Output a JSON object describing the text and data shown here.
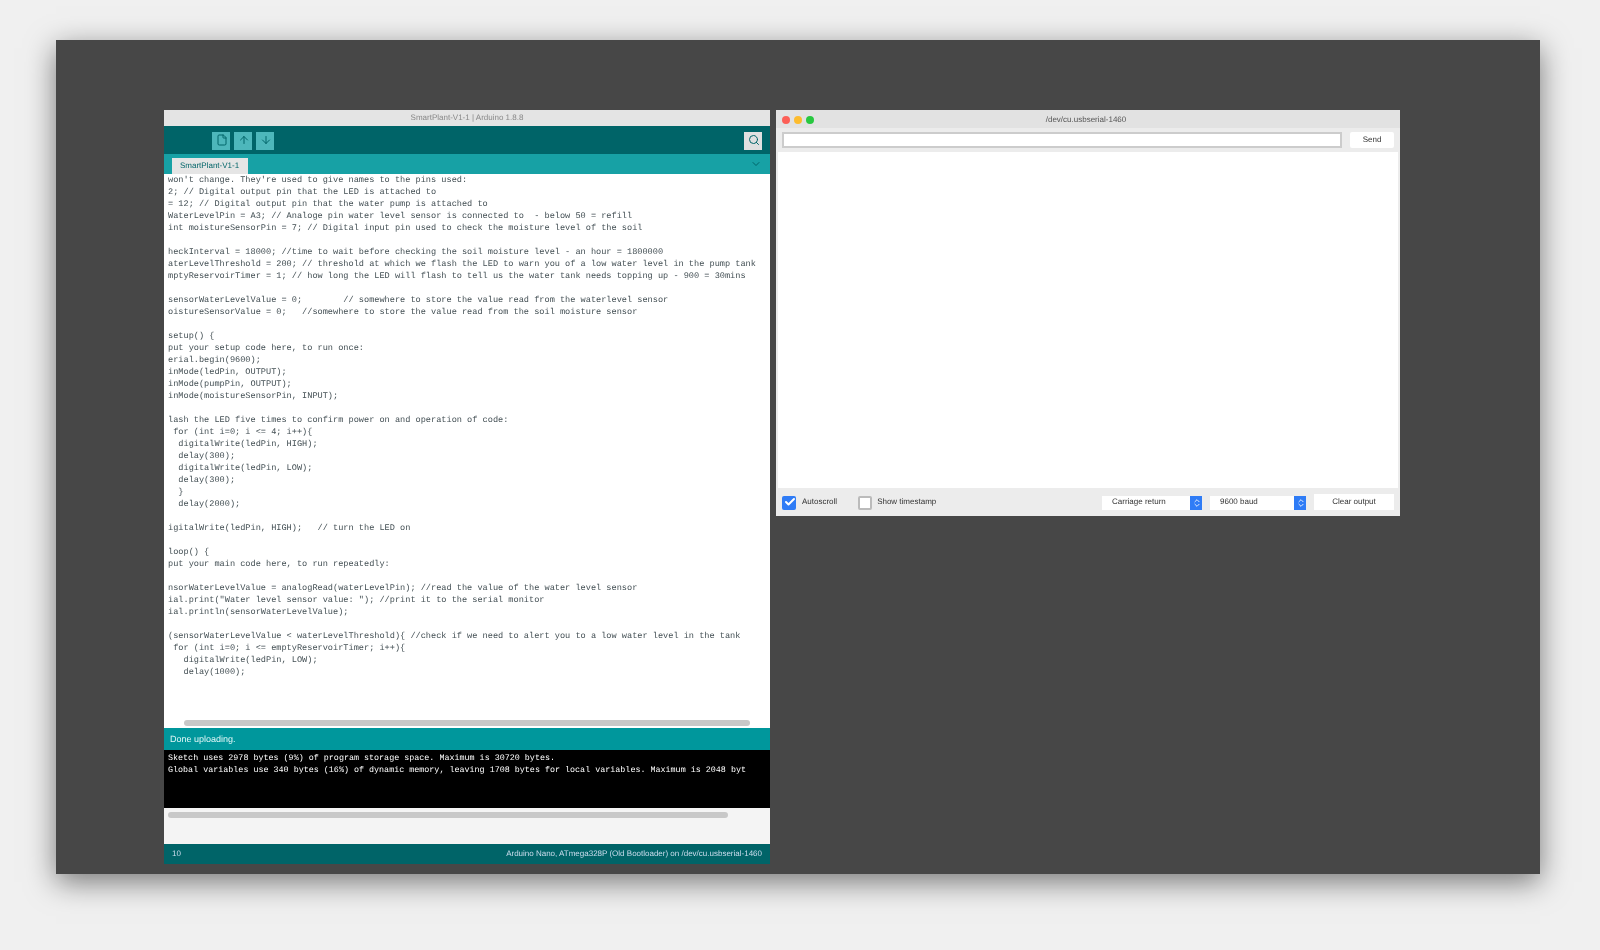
{
  "ide": {
    "title": "SmartPlant-V1-1 | Arduino 1.8.8",
    "tabs": [
      {
        "label": "SmartPlant-V1-1",
        "selected": true
      }
    ],
    "code_blocks": [
      [
        "won't change. They're used to give names to the pins used:",
        "2; // Digital output pin that the LED is attached to",
        "= 12; // Digital output pin that the water pump is attached to",
        "WaterLevelPin = A3; // Analoge pin water level sensor is connected to  - below 50 = refill",
        "int moistureSensorPin = 7; // Digital input pin used to check the moisture level of the soil"
      ],
      [
        "heckInterval = 18000; //time to wait before checking the soil moisture level - an hour = 1800000",
        "aterLevelThreshold = 200; // threshold at which we flash the LED to warn you of a low water level in the pump tank",
        "mptyReservoirTimer = 1; // how long the LED will flash to tell us the water tank needs topping up - 900 = 30mins"
      ],
      [
        "sensorWaterLevelValue = 0;        // somewhere to store the value read from the waterlevel sensor",
        "oistureSensorValue = 0;   //somewhere to store the value read from the soil moisture sensor"
      ],
      [
        "setup() {",
        "put your setup code here, to run once:",
        "erial.begin(9600);",
        "inMode(ledPin, OUTPUT);",
        "inMode(pumpPin, OUTPUT);",
        "inMode(moistureSensorPin, INPUT);"
      ],
      [
        "lash the LED five times to confirm power on and operation of code:",
        " for (int i=0; i <= 4; i++){",
        "  digitalWrite(ledPin, HIGH);",
        "  delay(300);",
        "  digitalWrite(ledPin, LOW);",
        "  delay(300);",
        "  }",
        "  delay(2000);"
      ],
      [
        "igitalWrite(ledPin, HIGH);   // turn the LED on"
      ],
      [
        "loop() {",
        "put your main code here, to run repeatedly:"
      ],
      [
        "nsorWaterLevelValue = analogRead(waterLevelPin); //read the value of the water level sensor",
        "ial.print(\"Water level sensor value: \"); //print it to the serial monitor",
        "ial.println(sensorWaterLevelValue);"
      ],
      [
        "(sensorWaterLevelValue < waterLevelThreshold){ //check if we need to alert you to a low water level in the tank",
        " for (int i=0; i <= emptyReservoirTimer; i++){",
        "   digitalWrite(ledPin, LOW);",
        "   delay(1000);"
      ]
    ],
    "status": "Done uploading.",
    "console": [
      "Sketch uses 2978 bytes (9%) of program storage space. Maximum is 30720 bytes.",
      "Global variables use 340 bytes (16%) of dynamic memory, leaving 1708 bytes for local variables. Maximum is 2048 byt"
    ],
    "footer": {
      "line": "10",
      "board": "Arduino Nano, ATmega328P (Old Bootloader) on /dev/cu.usbserial-1460"
    }
  },
  "serial_monitor": {
    "title": "/dev/cu.usbserial-1460",
    "send": "Send",
    "autoscroll": {
      "label": "Autoscroll",
      "checked": true
    },
    "timestamp": {
      "label": "Show timestamp",
      "checked": false
    },
    "line_ending": "Carriage return",
    "baud": "9600 baud",
    "clear": "Clear output"
  }
}
